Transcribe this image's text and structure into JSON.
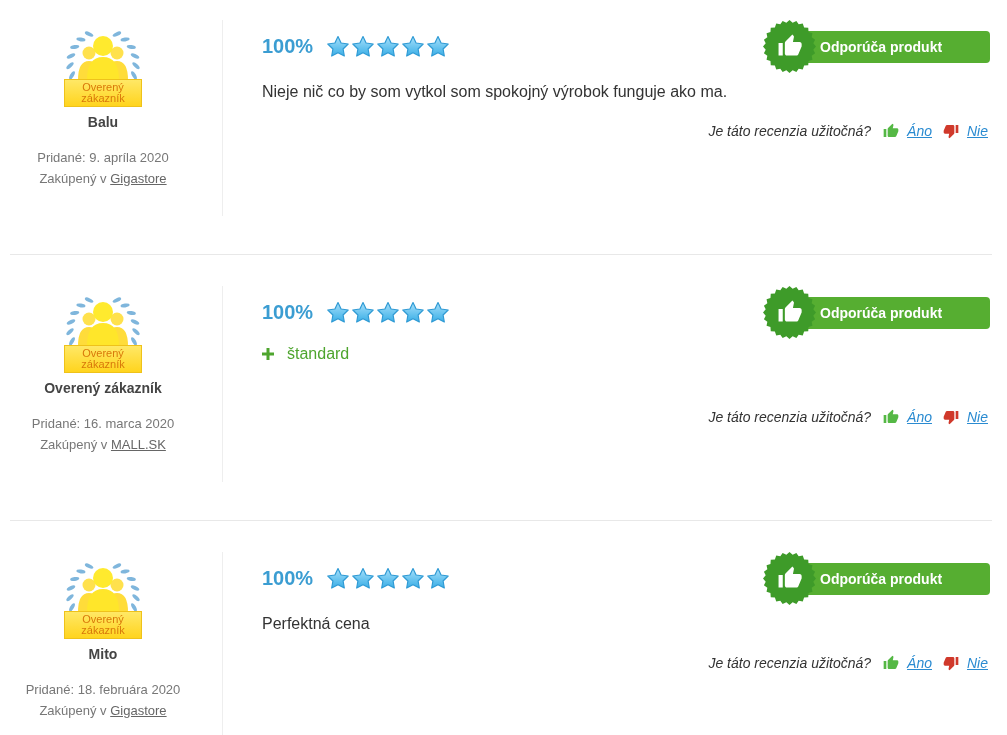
{
  "reviews": [
    {
      "badge": "Overený zákazník",
      "author": "Balu",
      "added": "Pridané: 9. apríla 2020",
      "purchased_at": "Zakúpený v",
      "shop": "Gigastore",
      "rating": "100%",
      "stars": 5,
      "recommendation": "Odporúča produkt",
      "text": "Nieje nič co by som vytkol som spokojný výrobok funguje ako ma.",
      "helpful": {
        "question": "Je táto recenzia užitočná?",
        "yes": "Áno",
        "no": "Nie"
      }
    },
    {
      "badge": "Overený zákazník",
      "author": "Overený zákazník",
      "added": "Pridané: 16. marca 2020",
      "purchased_at": "Zakúpený v",
      "shop": "MALL.SK",
      "rating": "100%",
      "stars": 5,
      "recommendation": "Odporúča produkt",
      "pros": [
        "štandard"
      ],
      "helpful": {
        "question": "Je táto recenzia užitočná?",
        "yes": "Áno",
        "no": "Nie"
      }
    },
    {
      "badge": "Overený zákazník",
      "author": "Mito",
      "added": "Pridané: 18. februára 2020",
      "purchased_at": "Zakúpený v",
      "shop": "Gigastore",
      "rating": "100%",
      "stars": 5,
      "recommendation": "Odporúča produkt",
      "text": "Perfektná cena",
      "helpful": {
        "question": "Je táto recenzia užitočná?",
        "yes": "Áno",
        "no": "Nie"
      }
    }
  ]
}
